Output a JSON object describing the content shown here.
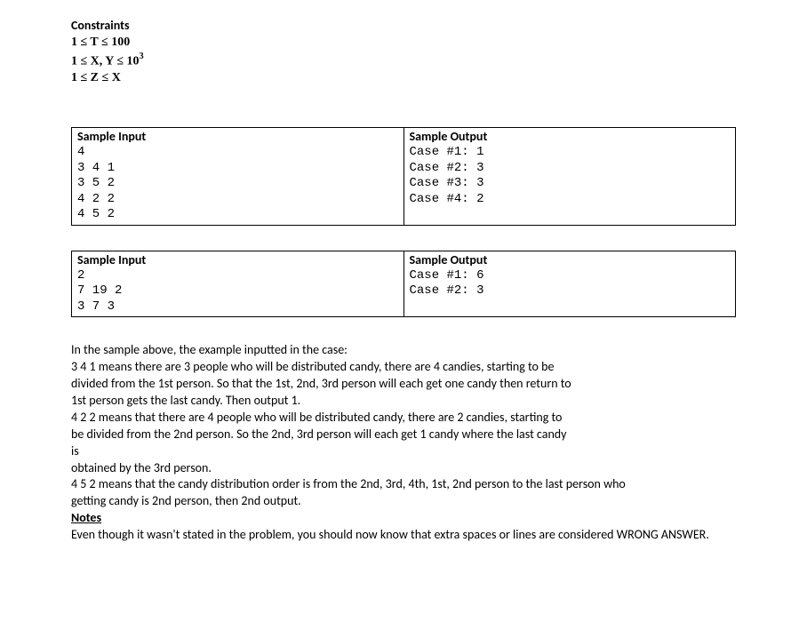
{
  "constraints": {
    "heading": "Constraints",
    "lines": [
      "1 ≤ T ≤ 100",
      "1 ≤ X, Y ≤ 10",
      "1 ≤ Z ≤ X"
    ],
    "exp": "3"
  },
  "samples": [
    {
      "input_header": "Sample Input",
      "output_header": "Sample Output",
      "input": "4\n3 4 1\n3 5 2\n4 2 2\n4 5 2",
      "output": "Case #1: 1\nCase #2: 3\nCase #3: 3\nCase #4: 2"
    },
    {
      "input_header": "Sample Input",
      "output_header": "Sample Output",
      "input": "2\n7 19 2\n3 7 3",
      "output": "Case #1: 6\nCase #2: 3"
    }
  ],
  "explanation": {
    "p1": "In the sample above, the example inputted in the case:",
    "p2": "3 4 1 means there are 3 people who will be distributed candy, there are 4 candies, starting to be",
    "p3": "divided from the 1st person. So that the 1st, 2nd, 3rd person will each get one candy then return to",
    "p4": "1st person gets the last candy. Then output 1.",
    "p5": "4 2 2 means that there are 4 people who will be distributed candy, there are 2 candies, starting to",
    "p6": "be divided from the 2nd person. So the 2nd, 3rd person will each get 1 candy where the last candy",
    "p7": " is",
    "p8": "obtained by the 3rd person.",
    "p9": "4 5 2 means that the candy distribution order is from the 2nd, 3rd, 4th, 1st, 2nd person to the last person who",
    "p10": "getting candy is 2nd person, then 2nd output."
  },
  "notes": {
    "heading": "Notes",
    "text": "Even though it wasn't stated in the problem, you should now know that extra spaces or lines are considered WRONG ANSWER."
  }
}
